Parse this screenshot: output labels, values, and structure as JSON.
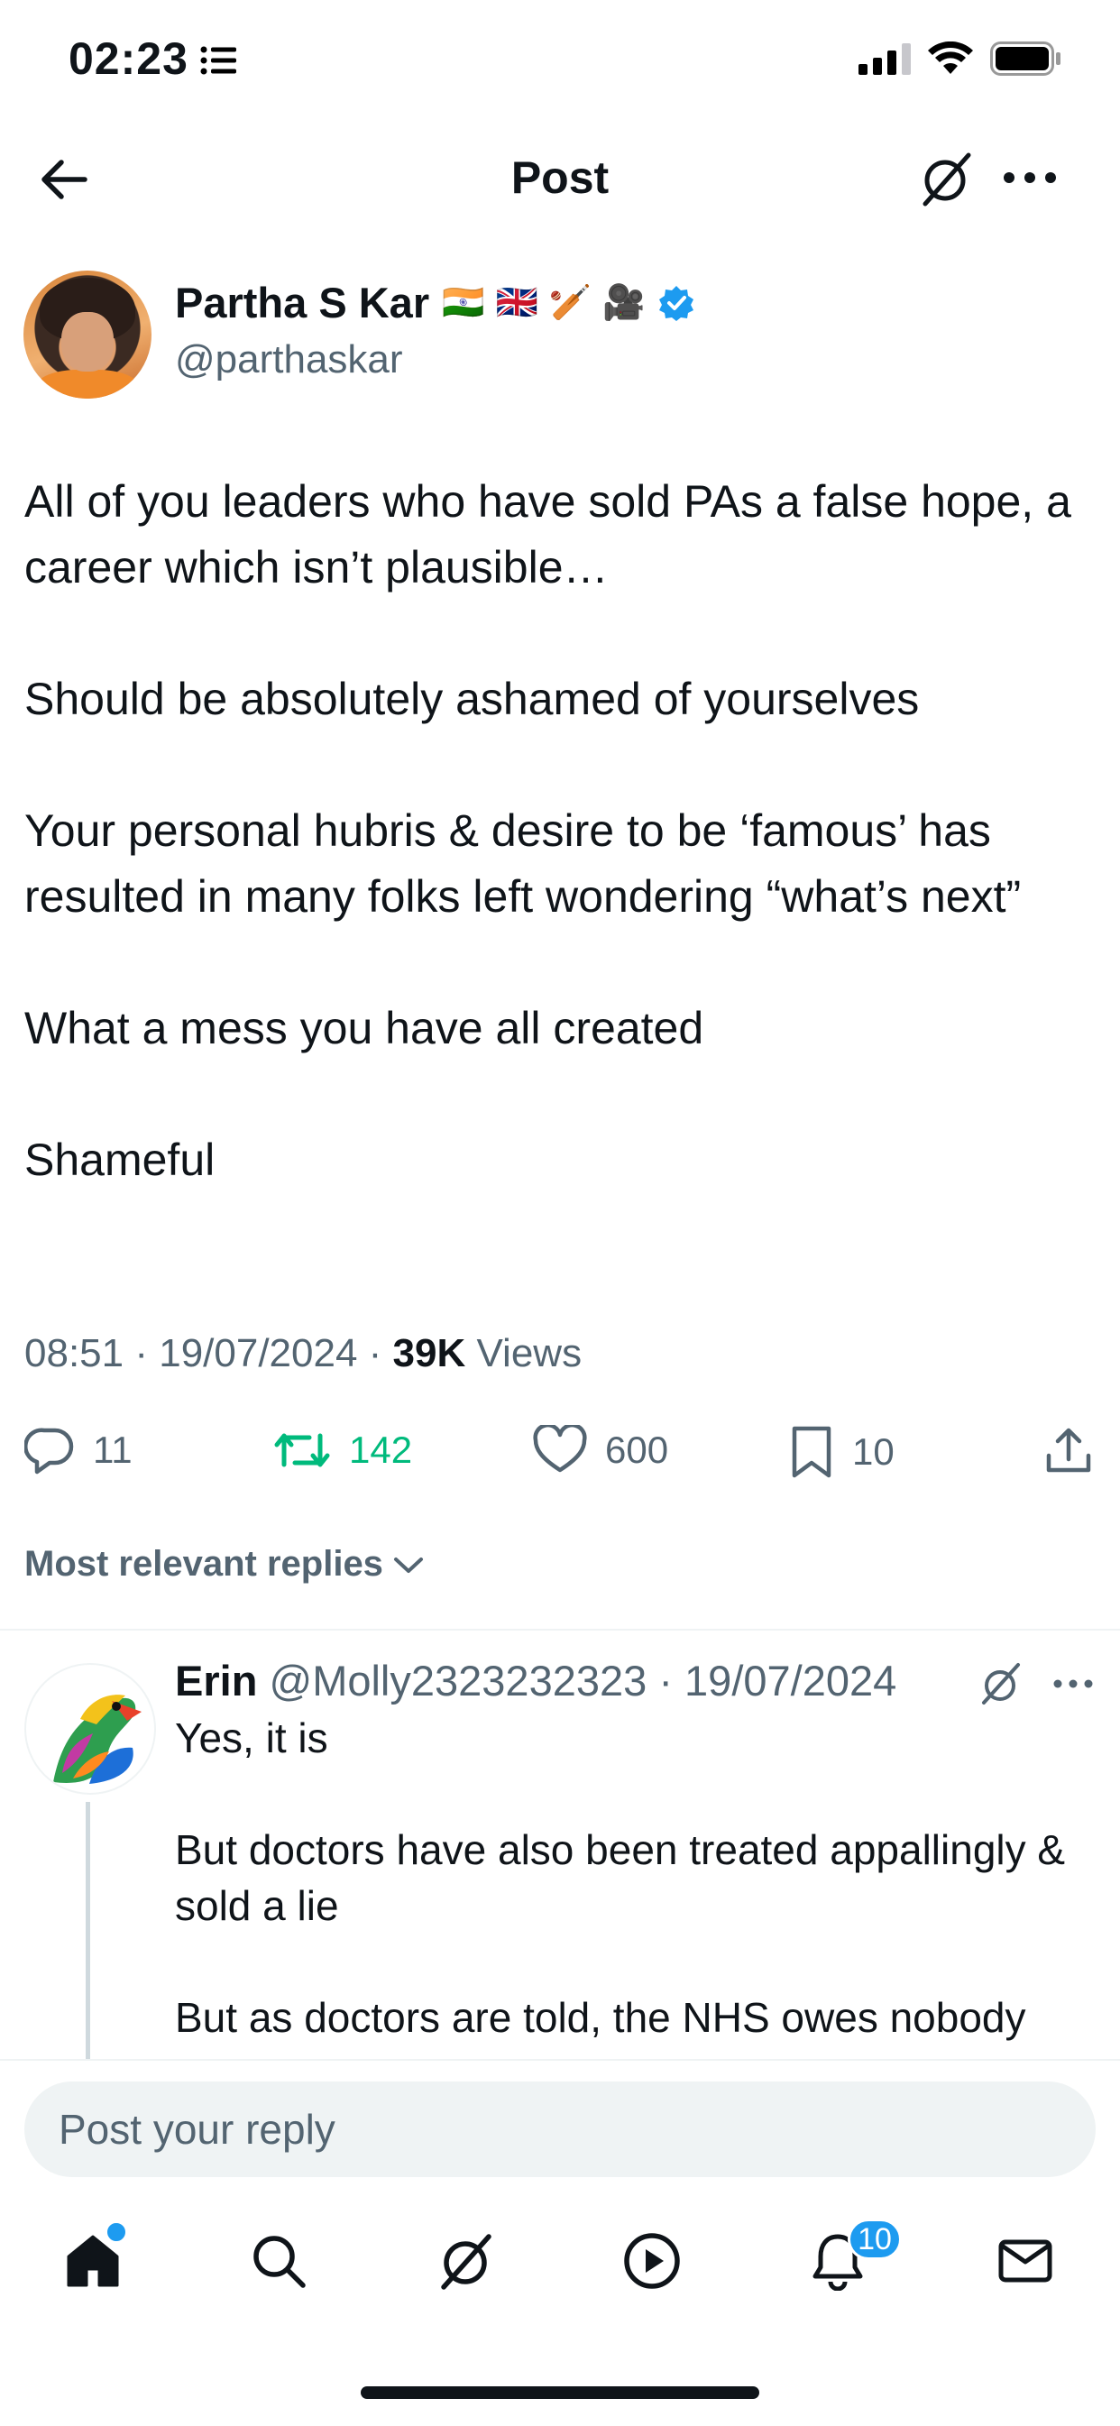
{
  "status_bar": {
    "time": "02:23"
  },
  "header": {
    "title": "Post"
  },
  "post": {
    "author_name": "Partha S Kar",
    "author_emojis": [
      "🇮🇳",
      "🇬🇧",
      "🏏",
      "🎥"
    ],
    "author_handle": "@parthaskar",
    "body": [
      "All of you leaders who have sold PAs a false hope, a career which isn’t plausible…",
      "Should be absolutely ashamed of yourselves",
      "Your personal hubris & desire to be ‘famous’ has resulted in many folks left wondering “what’s next”",
      "What a mess you have all created",
      "Shameful"
    ],
    "time": "08:51",
    "date": "19/07/2024",
    "views_count": "39K",
    "views_label": "Views",
    "replies": "11",
    "reposts": "142",
    "likes": "600",
    "bookmarks": "10"
  },
  "sort": {
    "label": "Most relevant replies"
  },
  "reply": {
    "name": "Erin",
    "handle": "@Molly2323232323",
    "date": "19/07/2024",
    "body": [
      "Yes, it is",
      "But doctors have also been treated appallingly & sold a lie",
      "But as doctors are told, the NHS owes nobody"
    ]
  },
  "compose": {
    "placeholder": "Post your reply"
  },
  "nav": {
    "items": [
      "home-icon",
      "search-icon",
      "grok-icon",
      "video-icon",
      "notifications-icon",
      "messages-icon"
    ],
    "notifications_badge": "10"
  },
  "colors": {
    "accent": "#1d9bf0",
    "repost": "#00ba7c",
    "secondary_text": "#536471"
  }
}
